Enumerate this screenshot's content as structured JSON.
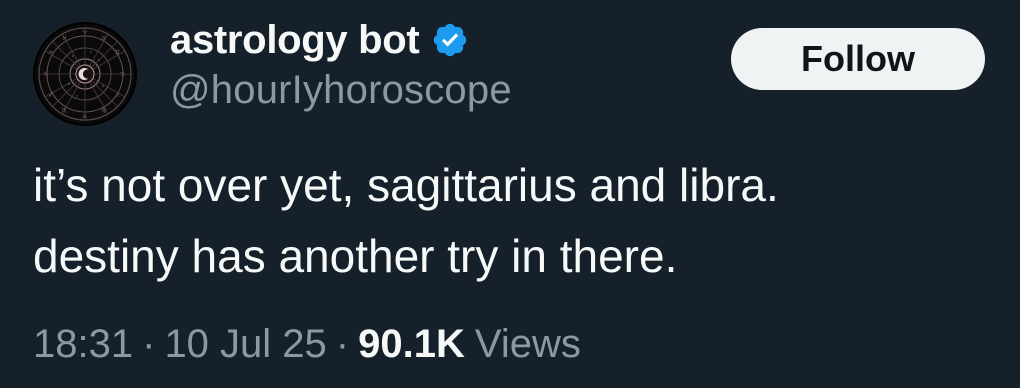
{
  "author": {
    "display_name": "astrology bot",
    "handle": "@hourIyhoroscope",
    "verified": true,
    "verified_color": "#1d9bf0"
  },
  "follow_button": {
    "label": "Follow"
  },
  "tweet": {
    "lines": [
      "it’s not over yet, sagittarius and libra.",
      "destiny has another try in there."
    ]
  },
  "meta": {
    "time": "18:31",
    "separator": "·",
    "date": "10 Jul 25",
    "views_count": "90.1K",
    "views_label": "Views"
  },
  "colors": {
    "background": "#15202b",
    "primary_text": "#f7f9f9",
    "secondary_text": "#8b98a5",
    "button_bg": "#eff3f4"
  }
}
